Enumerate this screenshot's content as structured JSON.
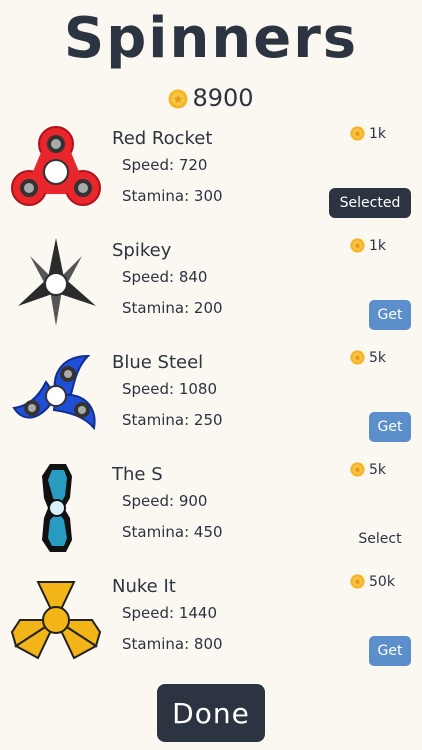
{
  "header": {
    "title": "Spinners",
    "coin_balance": "8900"
  },
  "spinners": [
    {
      "name": "Red Rocket",
      "speed": "Speed: 720",
      "stamina": "Stamina: 300",
      "price": "1k",
      "action": "Selected",
      "color": "#e8262b"
    },
    {
      "name": "Spikey",
      "speed": "Speed: 840",
      "stamina": "Stamina: 200",
      "price": "1k",
      "action": "Get",
      "color": "#2b2b2b"
    },
    {
      "name": "Blue Steel",
      "speed": "Speed: 1080",
      "stamina": "Stamina: 250",
      "price": "5k",
      "action": "Get",
      "color": "#1f4fd6"
    },
    {
      "name": "The S",
      "speed": "Speed: 900",
      "stamina": "Stamina: 450",
      "price": "5k",
      "action": "Select",
      "color": "#2a9bc0"
    },
    {
      "name": "Nuke It",
      "speed": "Speed: 1440",
      "stamina": "Stamina: 800",
      "price": "50k",
      "action": "Get",
      "color": "#f2b417"
    }
  ],
  "footer": {
    "done_label": "Done"
  },
  "colors": {
    "background": "#fbf8f1",
    "text": "#2b3440",
    "get_button": "#5b8fcc",
    "coin": "#f4b524"
  }
}
